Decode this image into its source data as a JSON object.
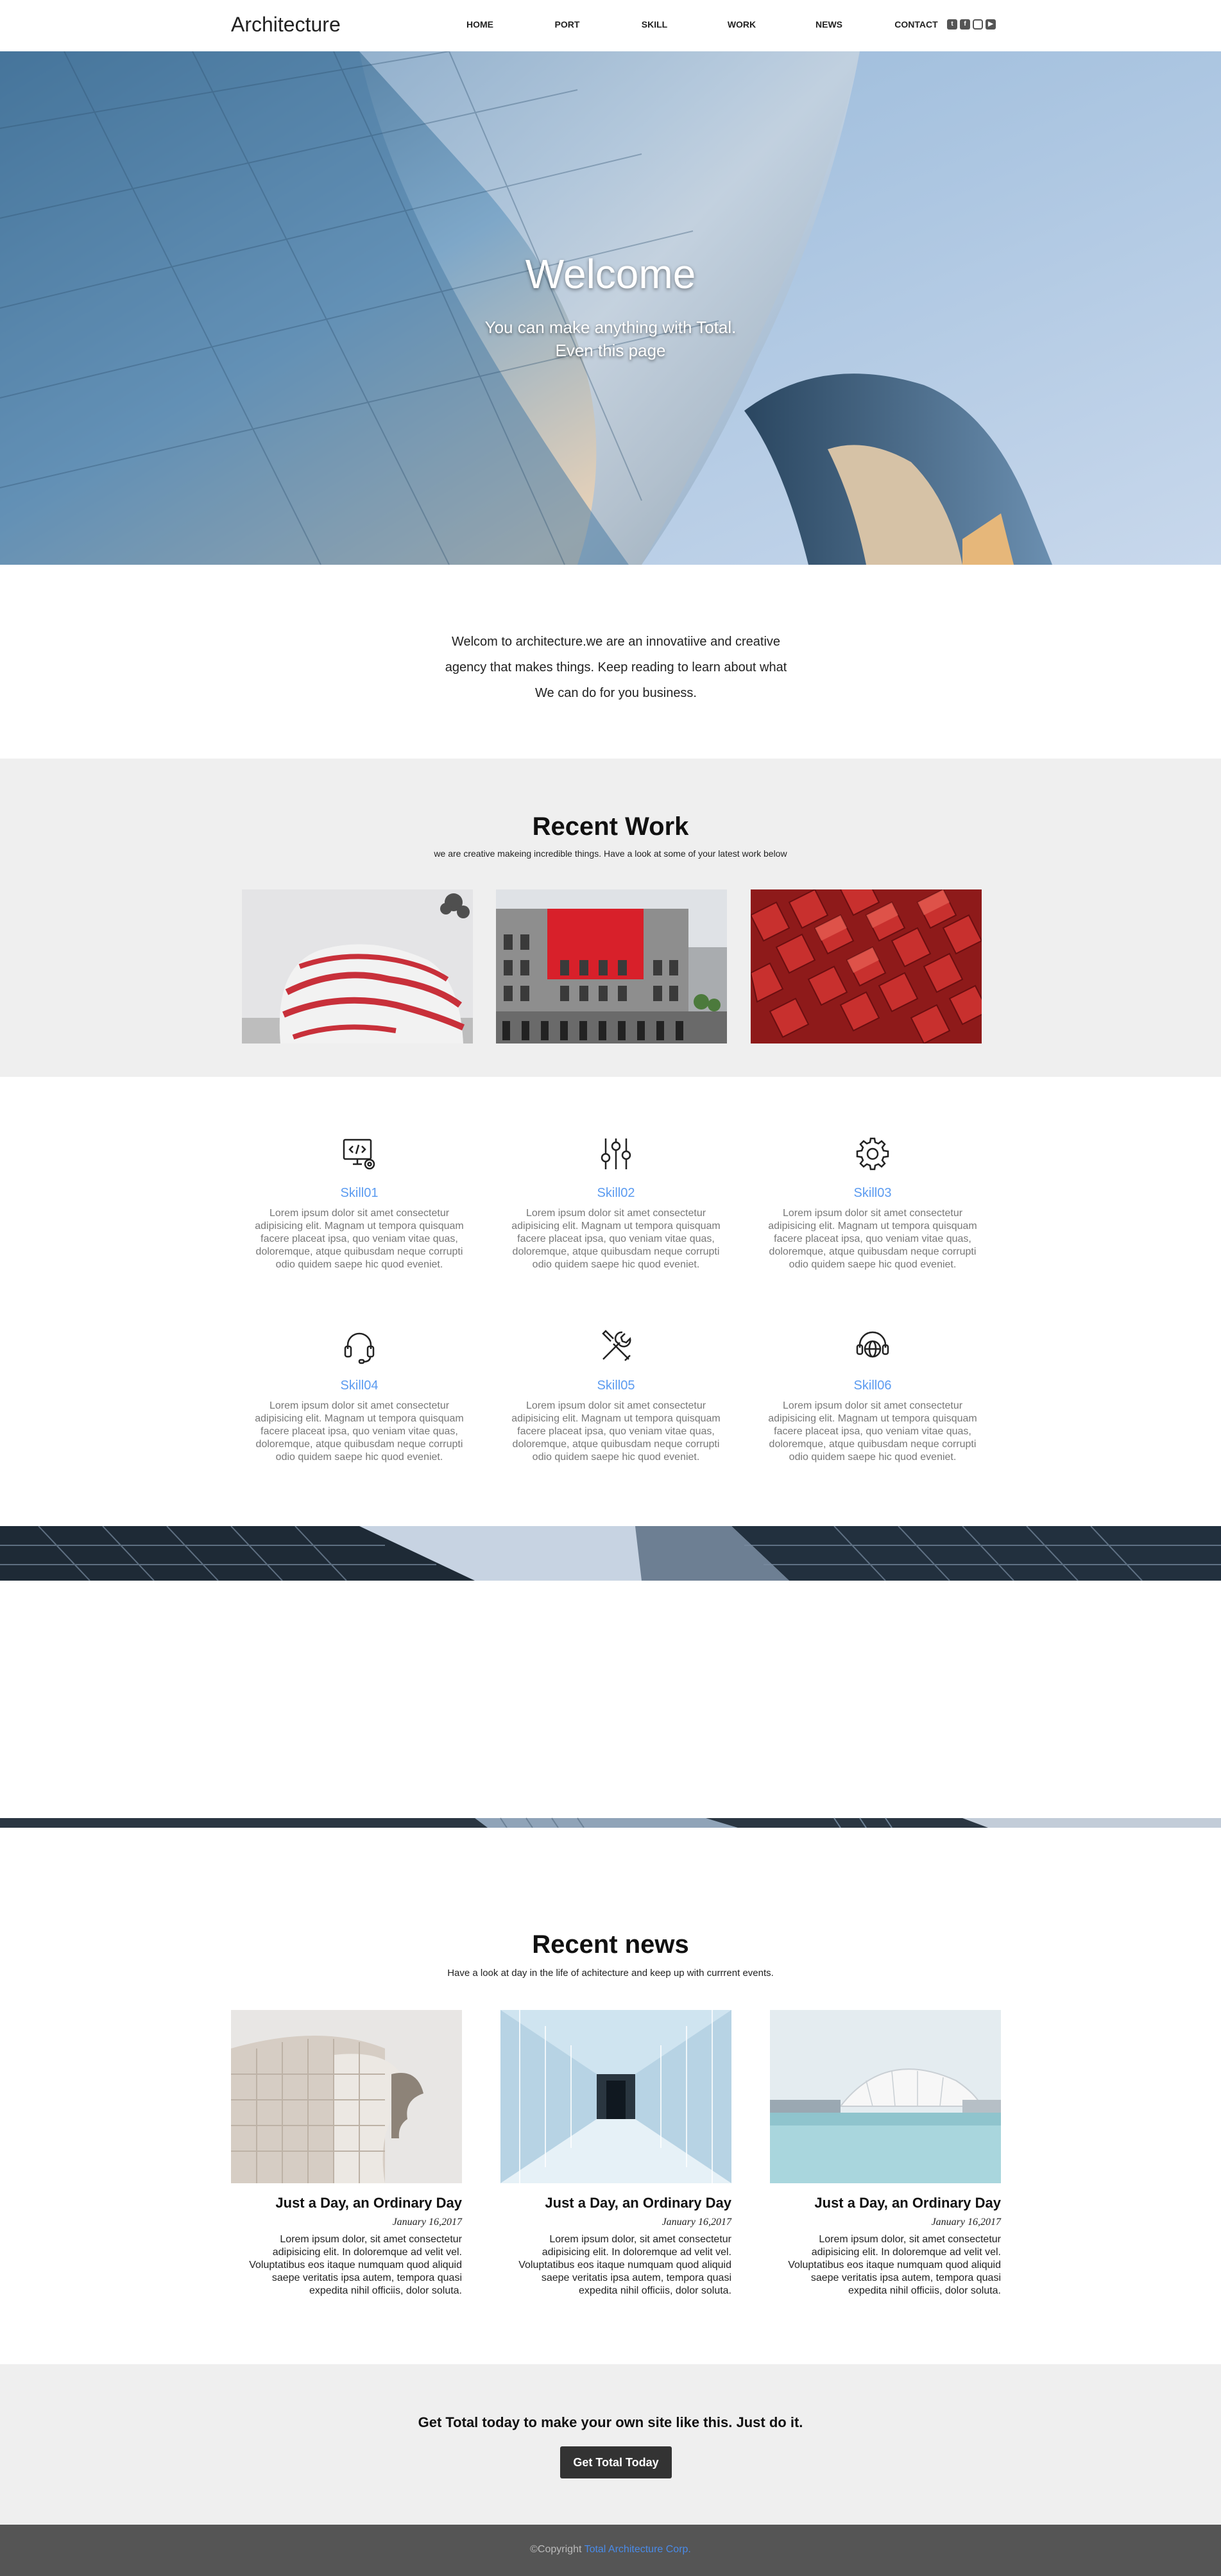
{
  "nav": {
    "brand": "Architecture",
    "items": [
      "HOME",
      "PORT",
      "SKILL",
      "WORK",
      "NEWS",
      "CONTACT"
    ],
    "social_icons": [
      "twitter-icon",
      "facebook-icon",
      "instagram-icon",
      "youtube-icon"
    ]
  },
  "hero": {
    "title": "Welcome",
    "subtitle_line1": "You can make anything with Total.",
    "subtitle_line2": "Even this page"
  },
  "intro": {
    "line1": "Welcom to architecture.we are an innovatiive and creative",
    "line2": "agency that makes things. Keep reading to learn about what",
    "line3": "We can do for you business."
  },
  "recent_work": {
    "title": "Recent Work",
    "subtitle": "we are creative makeing incredible things. Have a look at some of your latest work below"
  },
  "skills": [
    {
      "title": "Skill01",
      "icon": "monitor-code-icon",
      "text": "Lorem ipsum dolor sit amet consectetur adipisicing elit. Magnam ut tempora quisquam facere placeat ipsa, quo veniam vitae quas, doloremque, atque quibusdam neque corrupti odio quidem saepe hic quod eveniet."
    },
    {
      "title": "Skill02",
      "icon": "sliders-icon",
      "text": "Lorem ipsum dolor sit amet consectetur adipisicing elit. Magnam ut tempora quisquam facere placeat ipsa, quo veniam vitae quas, doloremque, atque quibusdam neque corrupti odio quidem saepe hic quod eveniet."
    },
    {
      "title": "Skill03",
      "icon": "gear-icon",
      "text": "Lorem ipsum dolor sit amet consectetur adipisicing elit. Magnam ut tempora quisquam facere placeat ipsa, quo veniam vitae quas, doloremque, atque quibusdam neque corrupti odio quidem saepe hic quod eveniet."
    },
    {
      "title": "Skill04",
      "icon": "headset-icon",
      "text": "Lorem ipsum dolor sit amet consectetur adipisicing elit. Magnam ut tempora quisquam facere placeat ipsa, quo veniam vitae quas, doloremque, atque quibusdam neque corrupti odio quidem saepe hic quod eveniet."
    },
    {
      "title": "Skill05",
      "icon": "tools-icon",
      "text": "Lorem ipsum dolor sit amet consectetur adipisicing elit. Magnam ut tempora quisquam facere placeat ipsa, quo veniam vitae quas, doloremque, atque quibusdam neque corrupti odio quidem saepe hic quod eveniet."
    },
    {
      "title": "Skill06",
      "icon": "support-globe-icon",
      "text": "Lorem ipsum dolor sit amet consectetur adipisicing elit. Magnam ut tempora quisquam facere placeat ipsa, quo veniam vitae quas, doloremque, atque quibusdam neque corrupti odio quidem saepe hic quod eveniet."
    }
  ],
  "news": {
    "title": "Recent news",
    "subtitle": "Have a look at day in the life of achitecture and keep up with currrent events.",
    "cards": [
      {
        "title": "Just a Day, an Ordinary Day",
        "date": "January 16,2017",
        "text": "Lorem ipsum dolor, sit amet consectetur adipisicing elit. In doloremque ad velit vel. Voluptatibus eos itaque numquam quod aliquid saepe veritatis ipsa autem, tempora quasi expedita nihil officiis, dolor soluta."
      },
      {
        "title": "Just a Day, an Ordinary Day",
        "date": "January 16,2017",
        "text": "Lorem ipsum dolor, sit amet consectetur adipisicing elit. In doloremque ad velit vel. Voluptatibus eos itaque numquam quod aliquid saepe veritatis ipsa autem, tempora quasi expedita nihil officiis, dolor soluta."
      },
      {
        "title": "Just a Day, an Ordinary Day",
        "date": "January 16,2017",
        "text": "Lorem ipsum dolor, sit amet consectetur adipisicing elit. In doloremque ad velit vel. Voluptatibus eos itaque numquam quod aliquid saepe veritatis ipsa autem, tempora quasi expedita nihil officiis, dolor soluta."
      }
    ]
  },
  "cta": {
    "text": "Get Total today to make your own site like this. Just do it.",
    "button": "Get Total Today"
  },
  "footer": {
    "copyright": "©Copyright",
    "company": "Total Architecture Corp."
  },
  "colors": {
    "accent": "#5b9bf0",
    "section_gray": "#efefef",
    "footer": "#555555",
    "button": "#333333"
  }
}
